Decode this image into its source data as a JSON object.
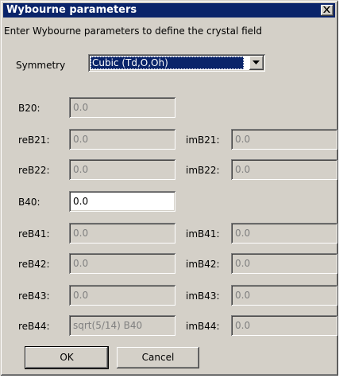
{
  "window": {
    "title": "Wybourne parameters",
    "instructions": "Enter Wybourne parameters to define the crystal field"
  },
  "symmetry": {
    "label": "Symmetry",
    "selected": "Cubic (Td,O,Oh)"
  },
  "fields": {
    "B20": {
      "label": "B20:",
      "value": "0.0"
    },
    "reB21": {
      "label": "reB21:",
      "value": "0.0"
    },
    "imB21": {
      "label": "imB21:",
      "value": "0.0"
    },
    "reB22": {
      "label": "reB22:",
      "value": "0.0"
    },
    "imB22": {
      "label": "imB22:",
      "value": "0.0"
    },
    "B40": {
      "label": "B40:",
      "value": "0.0"
    },
    "reB41": {
      "label": "reB41:",
      "value": "0.0"
    },
    "imB41": {
      "label": "imB41:",
      "value": "0.0"
    },
    "reB42": {
      "label": "reB42:",
      "value": "0.0"
    },
    "imB42": {
      "label": "imB42:",
      "value": "0.0"
    },
    "reB43": {
      "label": "reB43:",
      "value": "0.0"
    },
    "imB43": {
      "label": "imB43:",
      "value": "0.0"
    },
    "reB44": {
      "label": "reB44:",
      "value": "sqrt(5/14) B40"
    },
    "imB44": {
      "label": "imB44:",
      "value": "0.0"
    }
  },
  "buttons": {
    "ok": "OK",
    "cancel": "Cancel"
  },
  "colors": {
    "titlebar": "#0a246a",
    "face": "#d4d0c8",
    "selection": "#0a246a",
    "disabled_text": "#808080"
  },
  "icons": {
    "close": "close-icon",
    "dropdown": "chevron-down-icon"
  }
}
